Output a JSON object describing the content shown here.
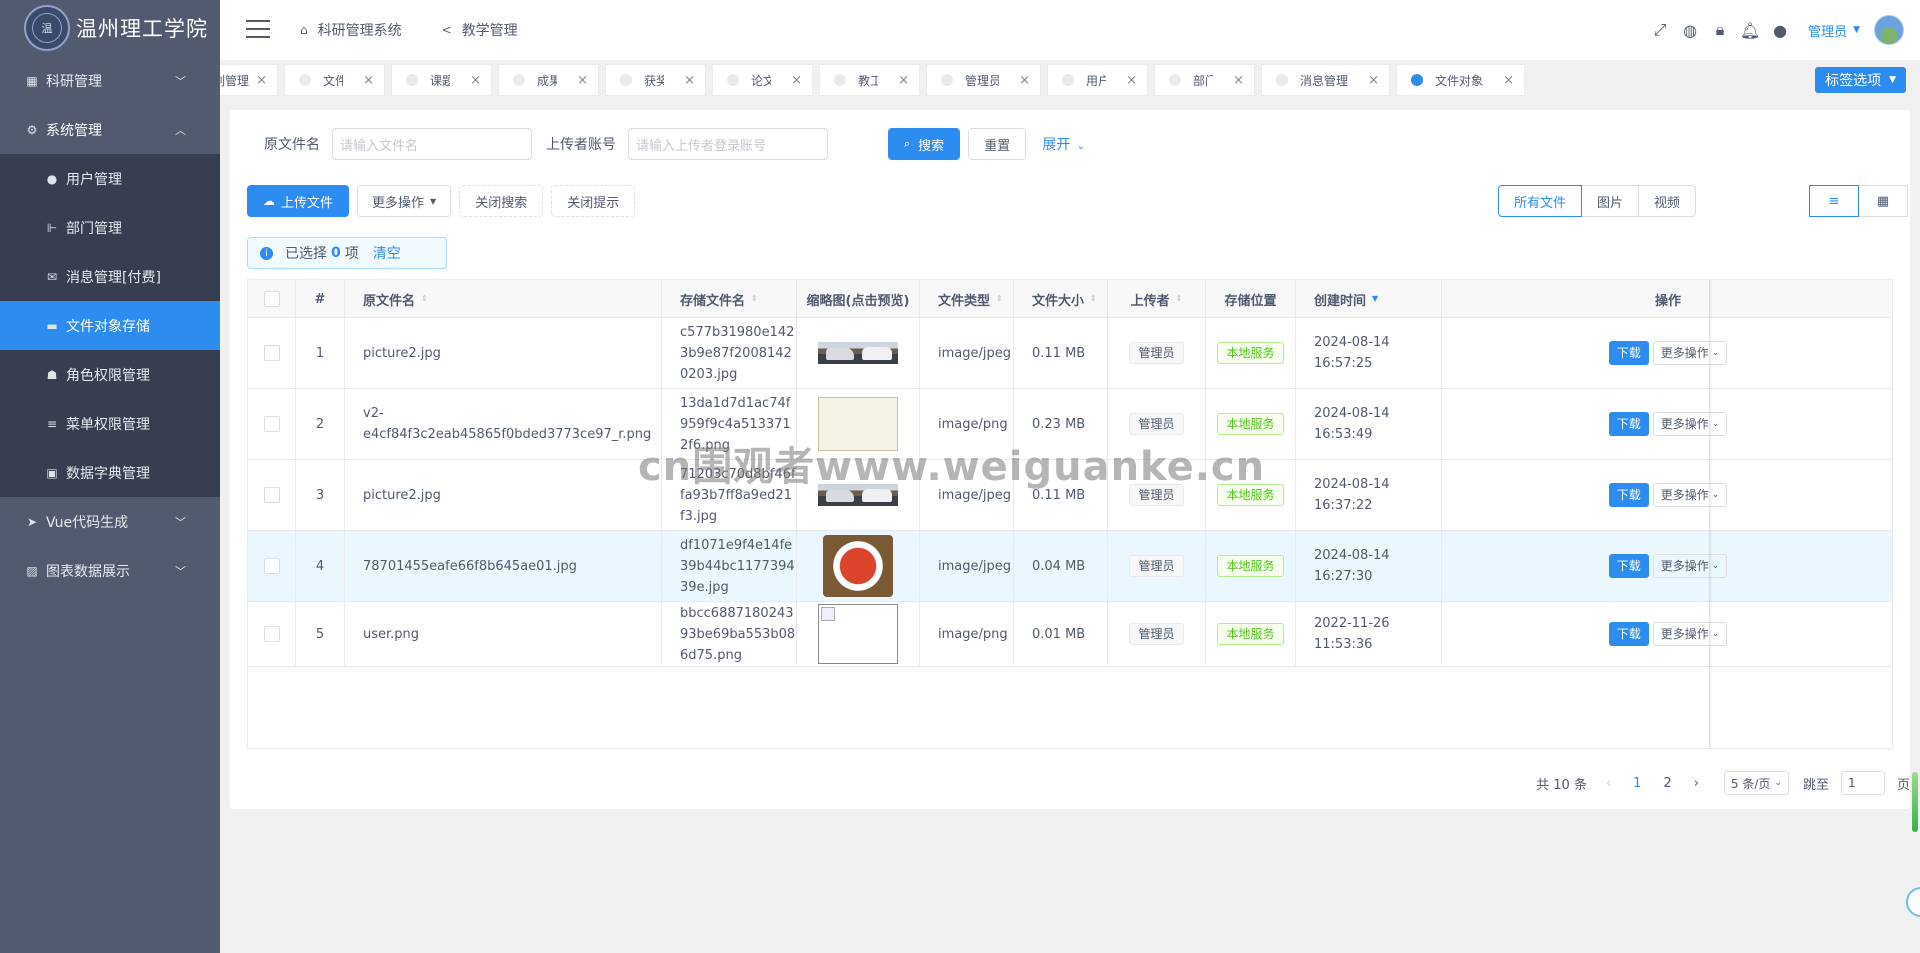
{
  "app": {
    "logo_title": "温州理工学院",
    "logo_mark": "温"
  },
  "sidebar": {
    "items": [
      {
        "label": "科研管理",
        "icon": "grid-icon",
        "glyph": "▦",
        "expanded": false
      },
      {
        "label": "系统管理",
        "icon": "gear-icon",
        "glyph": "⚙",
        "expanded": true
      },
      {
        "label": "Vue代码生成",
        "icon": "play-icon",
        "glyph": "➤",
        "expanded": false
      },
      {
        "label": "图表数据展示",
        "icon": "chart-icon",
        "glyph": "▨",
        "expanded": false
      }
    ],
    "sub_items": [
      {
        "label": "用户管理",
        "icon": "user-icon",
        "glyph": "●"
      },
      {
        "label": "部门管理",
        "icon": "dept-icon",
        "glyph": "⊩"
      },
      {
        "label": "消息管理[付费]",
        "icon": "mail-icon",
        "glyph": "✉"
      },
      {
        "label": "文件对象存储",
        "icon": "folder-icon",
        "glyph": "▬",
        "active": true
      },
      {
        "label": "角色权限管理",
        "icon": "role-icon",
        "glyph": "☗"
      },
      {
        "label": "菜单权限管理",
        "icon": "menu-icon",
        "glyph": "≡"
      },
      {
        "label": "数据字典管理",
        "icon": "dict-icon",
        "glyph": "▣"
      }
    ]
  },
  "header": {
    "nav": [
      {
        "label": "科研管理系统",
        "glyph": "⌂"
      },
      {
        "label": "教学管理",
        "glyph": "<"
      }
    ],
    "user": "管理员"
  },
  "tags": {
    "items": [
      {
        "label": "列管理"
      },
      {
        "label": "文件管理"
      },
      {
        "label": "课题管理"
      },
      {
        "label": "成果管理"
      },
      {
        "label": "获奖管理"
      },
      {
        "label": "论文管理"
      },
      {
        "label": "教工管理"
      },
      {
        "label": "管理员管理"
      },
      {
        "label": "用户管理"
      },
      {
        "label": "部门管理"
      },
      {
        "label": "消息管理[付费]"
      },
      {
        "label": "文件对象存储",
        "active": true
      }
    ],
    "options_label": "标签选项"
  },
  "search": {
    "name_label": "原文件名",
    "name_placeholder": "请输入文件名",
    "uploader_label": "上传者账号",
    "uploader_placeholder": "请输入上传者登录账号",
    "search_btn": "搜索",
    "reset_btn": "重置",
    "expand_link": "展开"
  },
  "toolbar": {
    "upload": "上传文件",
    "more": "更多操作",
    "close_search": "关闭搜索",
    "close_tip": "关闭提示"
  },
  "view_filters": [
    "所有文件",
    "图片",
    "视频"
  ],
  "alert": {
    "prefix": "已选择",
    "count": "0",
    "suffix": "项",
    "clear": "清空"
  },
  "table": {
    "columns": [
      "#",
      "原文件名",
      "存储文件名",
      "缩略图(点击预览)",
      "文件类型",
      "文件大小",
      "上传者",
      "存储位置",
      "创建时间",
      "操作"
    ],
    "rows": [
      {
        "index": "1",
        "name": "picture2.jpg",
        "store": "c577b31980e1423b9e87f20081420203.jpg",
        "thumb": "cars",
        "type": "image/jpeg",
        "size": "0.11 MB",
        "uploader": "管理员",
        "location": "本地服务",
        "created": "2024-08-14 16:57:25"
      },
      {
        "index": "2",
        "name": "v2-e4cf84f3c2eab45865f0bded3773ce97_r.png",
        "store": "13da1d7d1ac74f959f9c4a5133712f6.png",
        "thumb": "chart",
        "type": "image/png",
        "size": "0.23 MB",
        "uploader": "管理员",
        "location": "本地服务",
        "created": "2024-08-14 16:53:49"
      },
      {
        "index": "3",
        "name": "picture2.jpg",
        "store": "71203c70d8bf46ffa93b7ff8a9ed21f3.jpg",
        "thumb": "cars",
        "type": "image/jpeg",
        "size": "0.11 MB",
        "uploader": "管理员",
        "location": "本地服务",
        "created": "2024-08-14 16:37:22"
      },
      {
        "index": "4",
        "name": "78701455eafe66f8b645ae01.jpg",
        "store": "df1071e9f4e14fe39b44bc117739439e.jpg",
        "thumb": "food",
        "type": "image/jpeg",
        "size": "0.04 MB",
        "uploader": "管理员",
        "location": "本地服务",
        "created": "2024-08-14 16:27:30"
      },
      {
        "index": "5",
        "name": "user.png",
        "store": "bbcc688718024393be69ba553b086d75.png",
        "thumb": "broken",
        "type": "image/png",
        "size": "0.01 MB",
        "uploader": "管理员",
        "location": "本地服务",
        "created": "2022-11-26 11:53:36"
      }
    ],
    "op_download": "下载",
    "op_more": "更多操作"
  },
  "pagination": {
    "total": "共 10 条",
    "pages": [
      "1",
      "2"
    ],
    "current": "1",
    "page_size": "5 条/页",
    "jump_label": "跳至",
    "jump_value": "1",
    "page_suffix": "页"
  },
  "watermark": "cn围观者www.weiguanke.cn"
}
